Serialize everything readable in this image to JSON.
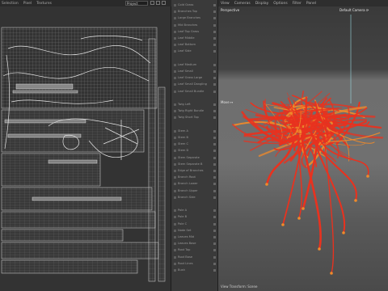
{
  "uv_editor": {
    "menu": [
      "Selection",
      "Pixel",
      "Textures"
    ],
    "project_select": "Project"
  },
  "object_list": {
    "items": [
      {
        "label": "Cold Grass",
        "y": 0
      },
      {
        "label": "Branches Top",
        "y": 1
      },
      {
        "label": "Large Branches",
        "y": 2
      },
      {
        "label": "Mid Branches",
        "y": 3
      },
      {
        "label": "Leaf Top Grass",
        "y": 4
      },
      {
        "label": "Leaf Middle",
        "y": 5
      },
      {
        "label": "Leaf Bottom",
        "y": 6
      },
      {
        "label": "Leaf Side",
        "y": 7
      },
      {
        "label": "Leaf Medium",
        "y": 9
      },
      {
        "label": "Leaf Small",
        "y": 10
      },
      {
        "label": "Leaf Grass Large",
        "y": 11
      },
      {
        "label": "Leaf Small Dangling",
        "y": 12
      },
      {
        "label": "Leaf Small Bundle",
        "y": 13
      },
      {
        "label": "Twig Left",
        "y": 15
      },
      {
        "label": "Twig Right Bundle",
        "y": 16
      },
      {
        "label": "Twig Short Top",
        "y": 17
      },
      {
        "label": "Stem A",
        "y": 19
      },
      {
        "label": "Stem B",
        "y": 20
      },
      {
        "label": "Stem C",
        "y": 21
      },
      {
        "label": "Stem D",
        "y": 22
      },
      {
        "label": "Stem Separate",
        "y": 23
      },
      {
        "label": "Stem Separate B",
        "y": 24
      },
      {
        "label": "Edge of Branches",
        "y": 25
      },
      {
        "label": "Branch Root",
        "y": 26
      },
      {
        "label": "Branch Lower",
        "y": 27
      },
      {
        "label": "Branch Upper",
        "y": 28
      },
      {
        "label": "Branch Side",
        "y": 29
      },
      {
        "label": "Pole A",
        "y": 31
      },
      {
        "label": "Pole B",
        "y": 32
      },
      {
        "label": "Pole C",
        "y": 33
      },
      {
        "label": "Node Set",
        "y": 34
      },
      {
        "label": "Leaves Mid",
        "y": 35
      },
      {
        "label": "Leaves Base",
        "y": 36
      },
      {
        "label": "Root Top",
        "y": 37
      },
      {
        "label": "Root Base",
        "y": 38
      },
      {
        "label": "Root Lines",
        "y": 39
      },
      {
        "label": "Bush",
        "y": 40
      }
    ]
  },
  "viewport": {
    "menu": [
      "View",
      "Cameras",
      "Display",
      "Options",
      "Filter",
      "Panel"
    ],
    "perspective_label": "Perspective",
    "camera_label": "Default Camera ⟳",
    "move_label": "Move ↔",
    "status_text": "View Transform: Scene",
    "accent_color": "#e8321f",
    "secondary_color": "#f08a2a"
  }
}
